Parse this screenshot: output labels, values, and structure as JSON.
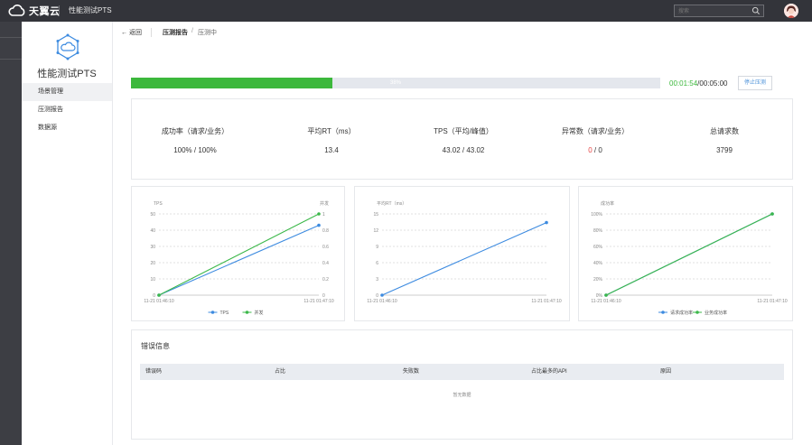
{
  "topbar": {
    "brand": "天翼云",
    "product": "性能测试PTS",
    "search_placeholder": "搜索"
  },
  "sidebar": {
    "title": "性能测试PTS",
    "items": [
      {
        "label": "场景管理",
        "active": true
      },
      {
        "label": "压测报告",
        "active": false
      },
      {
        "label": "数据源",
        "active": false
      }
    ]
  },
  "breadcrumb": {
    "back": "← 返回",
    "parent": "压测报告",
    "separator": "/",
    "current": "压测中"
  },
  "progress": {
    "percent_label": "38%",
    "fraction": 0.38,
    "elapsed": "00:01:54",
    "total": "/00:05:00",
    "stop_label": "停止压测"
  },
  "stats": [
    {
      "label": "成功率（请求/业务）",
      "value": "100% / 100%"
    },
    {
      "label": "平均RT（ms）",
      "value": "13.4"
    },
    {
      "label": "TPS（平均/峰值）",
      "value": "43.02 / 43.02"
    },
    {
      "label": "异常数（请求/业务）",
      "value_red": "0",
      "value_rest": " / 0"
    },
    {
      "label": "总请求数",
      "value": "3799"
    }
  ],
  "chart_data": [
    {
      "type": "line",
      "title": "",
      "ylabel": "TPS",
      "y2label": "并发",
      "x": [
        "11-21 01:46:10",
        "11-21 01:47:10"
      ],
      "ylim": [
        0,
        50
      ],
      "y_ticks": [
        "0",
        "10",
        "20",
        "30",
        "40",
        "50"
      ],
      "y2lim": [
        0,
        1
      ],
      "y2_ticks": [
        "0",
        "0.2",
        "0.4",
        "0.6",
        "0.8",
        "1"
      ],
      "series": [
        {
          "name": "TPS",
          "axis": "left",
          "values": [
            0,
            43
          ],
          "color": "#3d8be0"
        },
        {
          "name": "并发",
          "axis": "right",
          "values": [
            0,
            1
          ],
          "color": "#3cb84a"
        }
      ],
      "legend": "bottom"
    },
    {
      "type": "line",
      "title": "",
      "ylabel": "平均RT（ms）",
      "x": [
        "11-21 01:46:10",
        "11-21 01:47:10"
      ],
      "ylim": [
        0,
        15
      ],
      "y_ticks": [
        "0",
        "3",
        "6",
        "9",
        "12",
        "15"
      ],
      "series": [
        {
          "name": "",
          "axis": "left",
          "values": [
            0,
            13.4
          ],
          "color": "#3d8be0"
        }
      ],
      "legend": "none"
    },
    {
      "type": "line",
      "title": "",
      "ylabel": "成功率",
      "x": [
        "11-21 01:46:10",
        "11-21 01:47:10"
      ],
      "ylim": [
        0,
        100
      ],
      "y_ticks": [
        "0%",
        "20%",
        "40%",
        "60%",
        "80%",
        "100%"
      ],
      "series": [
        {
          "name": "请求成功率",
          "axis": "left",
          "values": [
            0,
            100
          ],
          "color": "#3d8be0"
        },
        {
          "name": "业务成功率",
          "axis": "left",
          "values": [
            0,
            100
          ],
          "color": "#3cb84a"
        }
      ],
      "legend": "bottom"
    }
  ],
  "errors": {
    "title": "错误信息",
    "columns": [
      "错误码",
      "占比",
      "失败数",
      "占比最多的API",
      "原因"
    ],
    "empty_text": "暂无数据"
  }
}
